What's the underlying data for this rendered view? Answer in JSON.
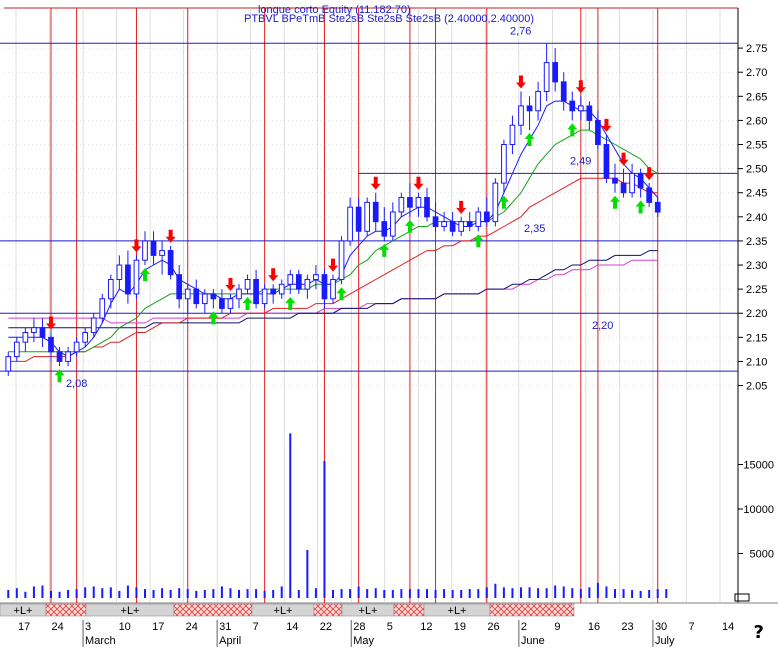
{
  "header": {
    "security": "longue corto Equity (11.182.70)",
    "studies": "PTBVL BPeTmB Ste2sB Ste2sB Ste2sB (2.40000,2.40000)"
  },
  "colors": {
    "background": "#ffffff",
    "up_candle": "#ffffff",
    "down_candle": "#1a1aff",
    "vertical_event_line": "#e02020",
    "gridline": "#c8c8c8",
    "horizontal_level": "#1d1dc8",
    "ma_fast": "#1a1aff",
    "ma_green": "#18a018",
    "ma_red": "#e02020",
    "ma_navy": "#101070",
    "ma_magenta": "#d040d0",
    "sell_arrow": "#ff0000",
    "buy_arrow": "#00e000",
    "volume_bar": "#1a1aff"
  },
  "chart_data": {
    "type": "candlestick",
    "x_tick_labels": [
      "17",
      "24",
      "3",
      "10",
      "17",
      "24",
      "31",
      "7",
      "14",
      "22",
      "28",
      "5",
      "12",
      "19",
      "26",
      "2",
      "9",
      "16",
      "23",
      "30",
      "7",
      "14"
    ],
    "month_labels": [
      "March",
      "April",
      "May",
      "June",
      "July"
    ],
    "price_axis": {
      "ticks": [
        "2.75",
        "2.70",
        "2.65",
        "2.60",
        "2.55",
        "2.50",
        "2.45",
        "2.40",
        "2.35",
        "2.30",
        "2.25",
        "2.20",
        "2.15",
        "2.10",
        "2.05"
      ],
      "ylim": [
        2.02,
        2.8
      ]
    },
    "volume_axis": {
      "ticks": [
        "15000",
        "10000",
        "5000"
      ],
      "ylim": [
        0,
        20000
      ]
    },
    "horizontal_levels": [
      {
        "value": 2.76,
        "label": "2,76"
      },
      {
        "value": 2.49,
        "label": "2,49"
      },
      {
        "value": 2.35,
        "label": "2,35"
      },
      {
        "value": 2.2,
        "label": "2,20"
      },
      {
        "value": 2.08,
        "label": "2,08"
      }
    ],
    "candles": [
      {
        "o": 2.08,
        "h": 2.12,
        "l": 2.07,
        "c": 2.11
      },
      {
        "o": 2.11,
        "h": 2.15,
        "l": 2.1,
        "c": 2.14
      },
      {
        "o": 2.14,
        "h": 2.17,
        "l": 2.12,
        "c": 2.16
      },
      {
        "o": 2.16,
        "h": 2.19,
        "l": 2.14,
        "c": 2.17
      },
      {
        "o": 2.17,
        "h": 2.19,
        "l": 2.13,
        "c": 2.15
      },
      {
        "o": 2.15,
        "h": 2.16,
        "l": 2.1,
        "c": 2.12
      },
      {
        "o": 2.12,
        "h": 2.13,
        "l": 2.09,
        "c": 2.1
      },
      {
        "o": 2.1,
        "h": 2.13,
        "l": 2.09,
        "c": 2.12
      },
      {
        "o": 2.12,
        "h": 2.15,
        "l": 2.11,
        "c": 2.14
      },
      {
        "o": 2.14,
        "h": 2.17,
        "l": 2.13,
        "c": 2.16
      },
      {
        "o": 2.16,
        "h": 2.2,
        "l": 2.15,
        "c": 2.19
      },
      {
        "o": 2.19,
        "h": 2.24,
        "l": 2.18,
        "c": 2.23
      },
      {
        "o": 2.23,
        "h": 2.28,
        "l": 2.21,
        "c": 2.27
      },
      {
        "o": 2.27,
        "h": 2.32,
        "l": 2.25,
        "c": 2.3
      },
      {
        "o": 2.3,
        "h": 2.33,
        "l": 2.22,
        "c": 2.24
      },
      {
        "o": 2.24,
        "h": 2.32,
        "l": 2.23,
        "c": 2.31
      },
      {
        "o": 2.31,
        "h": 2.37,
        "l": 2.3,
        "c": 2.35
      },
      {
        "o": 2.35,
        "h": 2.37,
        "l": 2.3,
        "c": 2.32
      },
      {
        "o": 2.32,
        "h": 2.35,
        "l": 2.28,
        "c": 2.33
      },
      {
        "o": 2.33,
        "h": 2.34,
        "l": 2.27,
        "c": 2.28
      },
      {
        "o": 2.28,
        "h": 2.3,
        "l": 2.21,
        "c": 2.23
      },
      {
        "o": 2.23,
        "h": 2.26,
        "l": 2.2,
        "c": 2.25
      },
      {
        "o": 2.25,
        "h": 2.27,
        "l": 2.21,
        "c": 2.22
      },
      {
        "o": 2.22,
        "h": 2.25,
        "l": 2.2,
        "c": 2.24
      },
      {
        "o": 2.24,
        "h": 2.25,
        "l": 2.21,
        "c": 2.23
      },
      {
        "o": 2.23,
        "h": 2.25,
        "l": 2.2,
        "c": 2.21
      },
      {
        "o": 2.21,
        "h": 2.24,
        "l": 2.2,
        "c": 2.23
      },
      {
        "o": 2.23,
        "h": 2.26,
        "l": 2.21,
        "c": 2.25
      },
      {
        "o": 2.25,
        "h": 2.28,
        "l": 2.24,
        "c": 2.27
      },
      {
        "o": 2.27,
        "h": 2.29,
        "l": 2.21,
        "c": 2.22
      },
      {
        "o": 2.22,
        "h": 2.26,
        "l": 2.21,
        "c": 2.25
      },
      {
        "o": 2.25,
        "h": 2.26,
        "l": 2.22,
        "c": 2.24
      },
      {
        "o": 2.24,
        "h": 2.27,
        "l": 2.23,
        "c": 2.26
      },
      {
        "o": 2.26,
        "h": 2.29,
        "l": 2.24,
        "c": 2.28
      },
      {
        "o": 2.28,
        "h": 2.29,
        "l": 2.24,
        "c": 2.25
      },
      {
        "o": 2.25,
        "h": 2.28,
        "l": 2.23,
        "c": 2.27
      },
      {
        "o": 2.27,
        "h": 2.3,
        "l": 2.25,
        "c": 2.28
      },
      {
        "o": 2.28,
        "h": 2.29,
        "l": 2.21,
        "c": 2.23
      },
      {
        "o": 2.23,
        "h": 2.28,
        "l": 2.22,
        "c": 2.27
      },
      {
        "o": 2.27,
        "h": 2.36,
        "l": 2.26,
        "c": 2.35
      },
      {
        "o": 2.35,
        "h": 2.44,
        "l": 2.34,
        "c": 2.42
      },
      {
        "o": 2.42,
        "h": 2.44,
        "l": 2.35,
        "c": 2.37
      },
      {
        "o": 2.37,
        "h": 2.44,
        "l": 2.36,
        "c": 2.43
      },
      {
        "o": 2.43,
        "h": 2.45,
        "l": 2.37,
        "c": 2.39
      },
      {
        "o": 2.39,
        "h": 2.42,
        "l": 2.35,
        "c": 2.36
      },
      {
        "o": 2.36,
        "h": 2.43,
        "l": 2.35,
        "c": 2.41
      },
      {
        "o": 2.41,
        "h": 2.45,
        "l": 2.4,
        "c": 2.44
      },
      {
        "o": 2.44,
        "h": 2.47,
        "l": 2.4,
        "c": 2.42
      },
      {
        "o": 2.42,
        "h": 2.45,
        "l": 2.4,
        "c": 2.44
      },
      {
        "o": 2.44,
        "h": 2.46,
        "l": 2.39,
        "c": 2.4
      },
      {
        "o": 2.4,
        "h": 2.43,
        "l": 2.37,
        "c": 2.38
      },
      {
        "o": 2.38,
        "h": 2.41,
        "l": 2.37,
        "c": 2.39
      },
      {
        "o": 2.39,
        "h": 2.41,
        "l": 2.36,
        "c": 2.37
      },
      {
        "o": 2.37,
        "h": 2.4,
        "l": 2.36,
        "c": 2.39
      },
      {
        "o": 2.39,
        "h": 2.41,
        "l": 2.37,
        "c": 2.38
      },
      {
        "o": 2.38,
        "h": 2.42,
        "l": 2.37,
        "c": 2.41
      },
      {
        "o": 2.41,
        "h": 2.44,
        "l": 2.38,
        "c": 2.39
      },
      {
        "o": 2.39,
        "h": 2.48,
        "l": 2.38,
        "c": 2.47
      },
      {
        "o": 2.47,
        "h": 2.56,
        "l": 2.45,
        "c": 2.55
      },
      {
        "o": 2.55,
        "h": 2.61,
        "l": 2.53,
        "c": 2.59
      },
      {
        "o": 2.59,
        "h": 2.66,
        "l": 2.57,
        "c": 2.63
      },
      {
        "o": 2.63,
        "h": 2.65,
        "l": 2.58,
        "c": 2.62
      },
      {
        "o": 2.62,
        "h": 2.68,
        "l": 2.6,
        "c": 2.66
      },
      {
        "o": 2.66,
        "h": 2.76,
        "l": 2.64,
        "c": 2.72
      },
      {
        "o": 2.72,
        "h": 2.75,
        "l": 2.66,
        "c": 2.68
      },
      {
        "o": 2.68,
        "h": 2.7,
        "l": 2.62,
        "c": 2.64
      },
      {
        "o": 2.64,
        "h": 2.66,
        "l": 2.6,
        "c": 2.62
      },
      {
        "o": 2.62,
        "h": 2.65,
        "l": 2.6,
        "c": 2.63
      },
      {
        "o": 2.63,
        "h": 2.64,
        "l": 2.58,
        "c": 2.6
      },
      {
        "o": 2.6,
        "h": 2.62,
        "l": 2.54,
        "c": 2.55
      },
      {
        "o": 2.55,
        "h": 2.57,
        "l": 2.47,
        "c": 2.48
      },
      {
        "o": 2.48,
        "h": 2.51,
        "l": 2.45,
        "c": 2.47
      },
      {
        "o": 2.47,
        "h": 2.5,
        "l": 2.44,
        "c": 2.45
      },
      {
        "o": 2.45,
        "h": 2.51,
        "l": 2.44,
        "c": 2.49
      },
      {
        "o": 2.49,
        "h": 2.5,
        "l": 2.44,
        "c": 2.46
      },
      {
        "o": 2.46,
        "h": 2.47,
        "l": 2.42,
        "c": 2.43
      },
      {
        "o": 2.43,
        "h": 2.44,
        "l": 2.4,
        "c": 2.41
      }
    ],
    "sell_signal_indices": [
      5,
      15,
      19,
      26,
      31,
      38,
      43,
      48,
      53,
      60,
      67,
      70,
      72,
      75
    ],
    "buy_signal_indices": [
      6,
      16,
      24,
      28,
      33,
      39,
      44,
      47,
      55,
      58,
      61,
      66,
      71,
      74
    ],
    "event_line_indices": [
      5,
      8,
      15,
      21,
      30,
      37,
      41,
      47,
      50,
      56,
      67,
      69,
      76
    ],
    "volumes": [
      900,
      1100,
      700,
      1300,
      1400,
      800,
      700,
      900,
      1000,
      1200,
      1300,
      1100,
      1200,
      800,
      1400,
      1200,
      1000,
      900,
      1100,
      900,
      1100,
      1000,
      800,
      900,
      1000,
      1300,
      1100,
      900,
      1000,
      1000,
      800,
      900,
      1300,
      18500,
      900,
      5400,
      1100,
      15400,
      900,
      1000,
      1000,
      1300,
      1000,
      1100,
      900,
      900,
      1000,
      1000,
      1000,
      1000,
      900,
      1000,
      900,
      900,
      1000,
      1000,
      1200,
      1600,
      1200,
      1100,
      1200,
      1200,
      1100,
      1100,
      1400,
      1300,
      1100,
      1000,
      1200,
      1700,
      1300,
      1000,
      1000,
      900,
      800,
      900,
      1000,
      1000
    ],
    "ma_fast": [
      2.15,
      2.15,
      2.15,
      2.15,
      2.15,
      2.14,
      2.12,
      2.11,
      2.12,
      2.13,
      2.15,
      2.18,
      2.22,
      2.25,
      2.24,
      2.26,
      2.29,
      2.3,
      2.31,
      2.3,
      2.27,
      2.26,
      2.25,
      2.24,
      2.24,
      2.23,
      2.23,
      2.24,
      2.24,
      2.24,
      2.24,
      2.24,
      2.25,
      2.26,
      2.26,
      2.26,
      2.27,
      2.26,
      2.26,
      2.28,
      2.32,
      2.34,
      2.36,
      2.37,
      2.37,
      2.38,
      2.4,
      2.41,
      2.42,
      2.42,
      2.41,
      2.4,
      2.39,
      2.38,
      2.38,
      2.39,
      2.39,
      2.41,
      2.45,
      2.49,
      2.53,
      2.56,
      2.59,
      2.63,
      2.64,
      2.64,
      2.63,
      2.62,
      2.62,
      2.6,
      2.57,
      2.54,
      2.51,
      2.49,
      2.48,
      2.46,
      2.44
    ],
    "ma_green": [
      2.12,
      2.12,
      2.12,
      2.12,
      2.12,
      2.12,
      2.12,
      2.12,
      2.12,
      2.12,
      2.13,
      2.14,
      2.15,
      2.17,
      2.18,
      2.19,
      2.21,
      2.22,
      2.23,
      2.24,
      2.24,
      2.24,
      2.24,
      2.24,
      2.24,
      2.24,
      2.24,
      2.24,
      2.24,
      2.24,
      2.25,
      2.25,
      2.25,
      2.25,
      2.25,
      2.25,
      2.26,
      2.26,
      2.26,
      2.27,
      2.28,
      2.3,
      2.31,
      2.33,
      2.34,
      2.35,
      2.36,
      2.37,
      2.38,
      2.38,
      2.39,
      2.39,
      2.39,
      2.39,
      2.39,
      2.39,
      2.39,
      2.4,
      2.41,
      2.43,
      2.45,
      2.48,
      2.51,
      2.53,
      2.55,
      2.56,
      2.57,
      2.58,
      2.58,
      2.57,
      2.56,
      2.55,
      2.54,
      2.53,
      2.52,
      2.5,
      2.49
    ],
    "ma_red": [
      2.1,
      2.1,
      2.1,
      2.11,
      2.11,
      2.11,
      2.11,
      2.11,
      2.12,
      2.12,
      2.13,
      2.13,
      2.14,
      2.14,
      2.15,
      2.16,
      2.16,
      2.17,
      2.18,
      2.18,
      2.18,
      2.19,
      2.19,
      2.19,
      2.19,
      2.19,
      2.2,
      2.2,
      2.2,
      2.2,
      2.2,
      2.21,
      2.21,
      2.21,
      2.21,
      2.21,
      2.22,
      2.22,
      2.22,
      2.23,
      2.24,
      2.25,
      2.26,
      2.27,
      2.28,
      2.29,
      2.3,
      2.31,
      2.32,
      2.33,
      2.33,
      2.34,
      2.34,
      2.35,
      2.35,
      2.36,
      2.36,
      2.37,
      2.38,
      2.39,
      2.4,
      2.42,
      2.43,
      2.44,
      2.45,
      2.46,
      2.47,
      2.48,
      2.48,
      2.48,
      2.48,
      2.48,
      2.47,
      2.47,
      2.46,
      2.45,
      2.45
    ],
    "ma_navy": [
      2.17,
      2.17,
      2.17,
      2.17,
      2.17,
      2.17,
      2.17,
      2.17,
      2.17,
      2.17,
      2.17,
      2.17,
      2.17,
      2.17,
      2.17,
      2.17,
      2.17,
      2.18,
      2.18,
      2.18,
      2.18,
      2.18,
      2.18,
      2.18,
      2.18,
      2.18,
      2.18,
      2.18,
      2.19,
      2.19,
      2.19,
      2.19,
      2.19,
      2.19,
      2.2,
      2.2,
      2.2,
      2.2,
      2.2,
      2.21,
      2.21,
      2.21,
      2.21,
      2.22,
      2.22,
      2.22,
      2.23,
      2.23,
      2.23,
      2.23,
      2.23,
      2.24,
      2.24,
      2.24,
      2.24,
      2.24,
      2.25,
      2.25,
      2.25,
      2.26,
      2.26,
      2.27,
      2.27,
      2.28,
      2.29,
      2.29,
      2.3,
      2.3,
      2.31,
      2.31,
      2.31,
      2.32,
      2.32,
      2.32,
      2.32,
      2.33,
      2.33
    ],
    "ma_magenta": [
      2.19,
      2.19,
      2.19,
      2.19,
      2.19,
      2.19,
      2.19,
      2.19,
      2.19,
      2.19,
      2.19,
      2.19,
      2.18,
      2.18,
      2.18,
      2.18,
      2.18,
      2.19,
      2.19,
      2.19,
      2.19,
      2.19,
      2.19,
      2.19,
      2.19,
      2.19,
      2.19,
      2.19,
      2.2,
      2.2,
      2.2,
      2.2,
      2.2,
      2.2,
      2.2,
      2.2,
      2.2,
      2.21,
      2.21,
      2.21,
      2.21,
      2.21,
      2.22,
      2.22,
      2.22,
      2.22,
      2.23,
      2.23,
      2.23,
      2.23,
      2.23,
      2.24,
      2.24,
      2.24,
      2.24,
      2.24,
      2.25,
      2.25,
      2.25,
      2.25,
      2.26,
      2.26,
      2.27,
      2.27,
      2.28,
      2.28,
      2.29,
      2.29,
      2.29,
      2.3,
      2.3,
      2.3,
      2.3,
      2.31,
      2.31,
      2.31,
      2.31
    ],
    "signal_strip": [
      {
        "label": "+L+",
        "kind": "long"
      },
      {
        "label": "",
        "kind": "short"
      },
      {
        "label": "+L+",
        "kind": "long"
      },
      {
        "label": "",
        "kind": "short"
      },
      {
        "label": "+L+",
        "kind": "long"
      },
      {
        "label": "",
        "kind": "short"
      },
      {
        "label": "+L+",
        "kind": "long"
      },
      {
        "label": "",
        "kind": "short"
      },
      {
        "label": "+L+",
        "kind": "long"
      },
      {
        "label": "",
        "kind": "short"
      }
    ]
  },
  "footer": {
    "help_glyph": "?"
  }
}
